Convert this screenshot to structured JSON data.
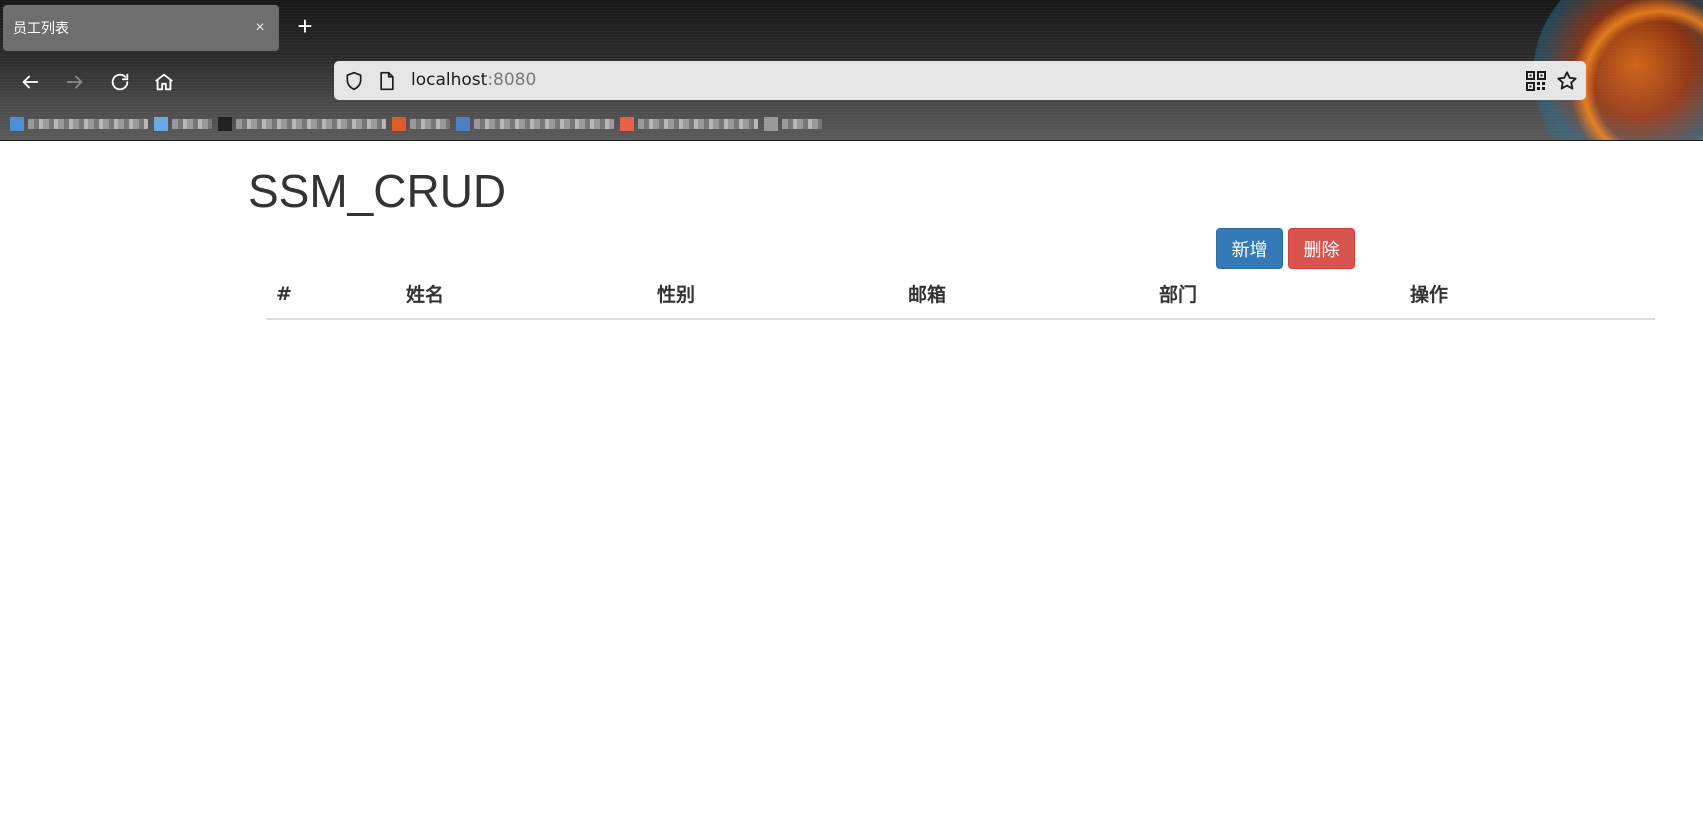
{
  "browser": {
    "tab": {
      "title": "员工列表",
      "close_glyph": "×"
    },
    "new_tab_glyph": "+",
    "nav": {
      "back_icon": "arrow-left-icon",
      "forward_icon": "arrow-right-icon",
      "reload_icon": "reload-icon",
      "home_icon": "home-icon"
    },
    "url": {
      "host": "localhost",
      "port": ":8080"
    },
    "bookmarks": [
      {
        "icon_color": "#4a8fd8"
      },
      {
        "icon_color": "#6aa8e8"
      },
      {
        "icon_color": "#222222"
      },
      {
        "icon_color": "#e05a2a"
      },
      {
        "icon_color": "#4b7fc8"
      },
      {
        "icon_color": "#e8604a"
      },
      {
        "icon_color": "#9a9a9a"
      }
    ]
  },
  "page": {
    "title": "SSM_CRUD",
    "buttons": {
      "add": "新增",
      "delete": "删除"
    },
    "table": {
      "headers": [
        "#",
        "姓名",
        "性别",
        "邮箱",
        "部门",
        "操作"
      ]
    }
  },
  "colors": {
    "primary": "#337ab7",
    "danger": "#d9534f",
    "text": "#333333"
  }
}
